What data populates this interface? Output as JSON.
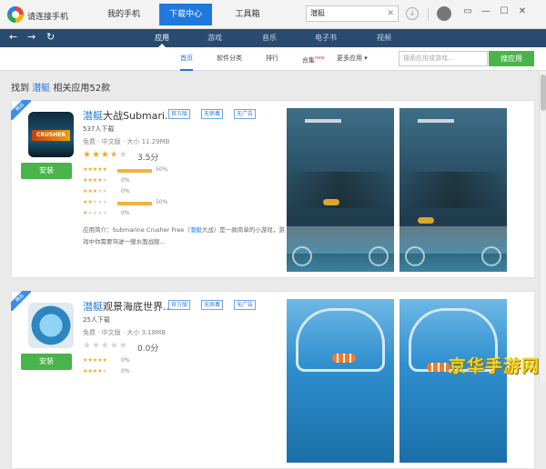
{
  "titlebar": {
    "app_name": "请连接手机",
    "nav": [
      "我的手机",
      "下载中心",
      "工具箱"
    ],
    "active_nav": 1,
    "search_value": "潜艇",
    "search_clear": "✕",
    "download_icon": "download-icon",
    "window_controls": [
      "▭",
      "—",
      "☐",
      "✕"
    ]
  },
  "navbar": {
    "back": "←",
    "forward": "→",
    "refresh": "↻",
    "tabs": [
      "应用",
      "游戏",
      "音乐",
      "电子书",
      "视频"
    ],
    "active_tab": 0
  },
  "subnav": {
    "items": [
      "首页",
      "软件分类",
      "排行",
      "合集",
      "更多应用 ▾"
    ],
    "active": 0,
    "new_badge": "new",
    "search_placeholder": "搜索应用或游戏...",
    "search_button": "搜应用"
  },
  "results": {
    "prefix": "找到",
    "keyword": "潜艇",
    "suffix": "相关应用52款"
  },
  "apps": [
    {
      "ribbon": "精品",
      "title_keyword": "潜艇",
      "title_rest": "大战Submari...",
      "badges": [
        "官方版",
        "无病毒",
        "无广告"
      ],
      "downloads": "537人下载",
      "meta": "免费 · 中文版 · 大小 11.29MB",
      "rating": 3.5,
      "score_text": "3.5分",
      "breakdown": [
        {
          "stars": 5,
          "pct": "50%",
          "frac": 0.5
        },
        {
          "stars": 4,
          "pct": "0%",
          "frac": 0
        },
        {
          "stars": 3,
          "pct": "0%",
          "frac": 0
        },
        {
          "stars": 2,
          "pct": "50%",
          "frac": 0.5
        },
        {
          "stars": 1,
          "pct": "0%",
          "frac": 0
        }
      ],
      "desc_prefix": "应用简介：Submarine Crusher Free（",
      "desc_keyword": "潜艇",
      "desc_suffix": "大战）是一款简单的小游戏，游戏中你需要驾驶一艘水面战舰...",
      "install": "安装",
      "icon_text": "CRUSHER"
    },
    {
      "ribbon": "精品",
      "title_keyword": "潜艇",
      "title_rest": "观景海底世界...",
      "badges": [
        "官方版",
        "无病毒",
        "无广告"
      ],
      "downloads": "25人下载",
      "meta": "免费 · 中文版 · 大小 3.18MB",
      "rating": 0,
      "score_text": "0.0分",
      "breakdown": [
        {
          "stars": 5,
          "pct": "0%",
          "frac": 0
        },
        {
          "stars": 4,
          "pct": "0%",
          "frac": 0
        }
      ],
      "install": "安装"
    }
  ],
  "watermark": "京华手游网"
}
